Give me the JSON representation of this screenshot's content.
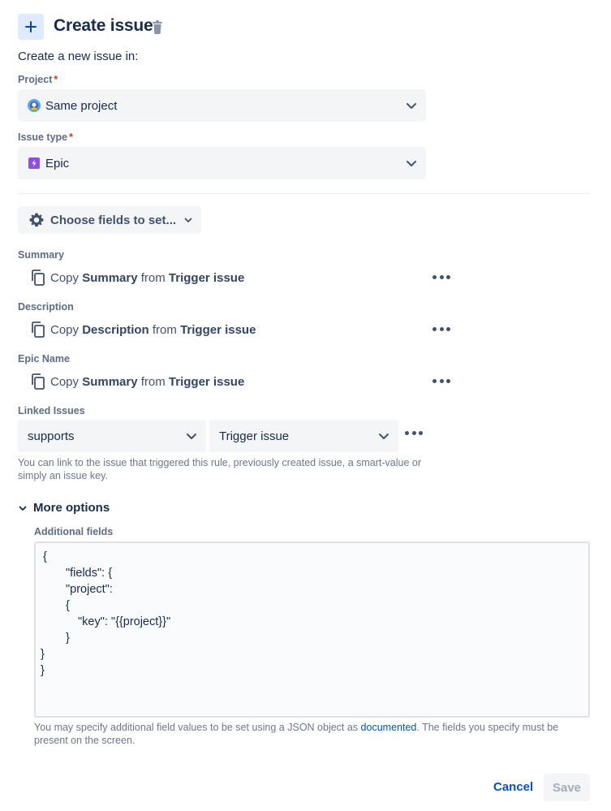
{
  "header": {
    "title": "Create issue",
    "intro": "Create a new issue in:"
  },
  "project": {
    "label": "Project",
    "required_mark": "*",
    "value": "Same project"
  },
  "issue_type": {
    "label": "Issue type",
    "required_mark": "*",
    "value": "Epic"
  },
  "choose_fields": {
    "label": "Choose fields to set..."
  },
  "fields": [
    {
      "label": "Summary",
      "prefix": "Copy",
      "field": "Summary",
      "mid": "from",
      "source": "Trigger issue"
    },
    {
      "label": "Description",
      "prefix": "Copy",
      "field": "Description",
      "mid": "from",
      "source": "Trigger issue"
    },
    {
      "label": "Epic Name",
      "prefix": "Copy",
      "field": "Summary",
      "mid": "from",
      "source": "Trigger issue"
    }
  ],
  "linked_issues": {
    "label": "Linked Issues",
    "link_type": "supports",
    "target": "Trigger issue",
    "help": "You can link to the issue that triggered this rule, previously created issue, a smart-value or simply an issue key."
  },
  "more_options": {
    "label": "More options",
    "additional_fields_label": "Additional fields",
    "json_lines": [
      "{",
      "\"fields\": {",
      "\"project\":",
      "{",
      "\"key\": \"{{project}}\"",
      "}",
      "}",
      "}"
    ],
    "help_before": "You may specify additional field values to be set using a JSON object as ",
    "help_link": "documented",
    "help_after": ". The fields you specify must be present on the screen."
  },
  "footer": {
    "cancel": "Cancel",
    "save": "Save"
  },
  "colors": {
    "accent": "#0052cc",
    "epic": "#904ee2",
    "required": "#de350b"
  }
}
